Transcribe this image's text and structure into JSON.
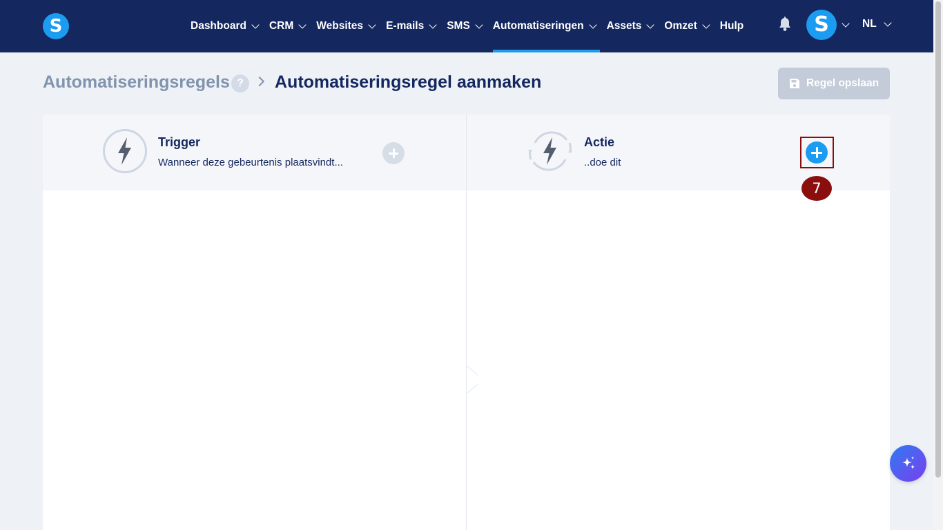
{
  "nav": {
    "logo_letter": "S",
    "items": [
      {
        "label": "Dashboard",
        "has_dropdown": true,
        "active": false
      },
      {
        "label": "CRM",
        "has_dropdown": true,
        "active": false
      },
      {
        "label": "Websites",
        "has_dropdown": true,
        "active": false
      },
      {
        "label": "E-mails",
        "has_dropdown": true,
        "active": false
      },
      {
        "label": "SMS",
        "has_dropdown": true,
        "active": false
      },
      {
        "label": "Automatiseringen",
        "has_dropdown": true,
        "active": true
      },
      {
        "label": "Assets",
        "has_dropdown": true,
        "active": false
      },
      {
        "label": "Omzet",
        "has_dropdown": true,
        "active": false
      },
      {
        "label": "Hulp",
        "has_dropdown": false,
        "active": false
      }
    ],
    "avatar_letter": "S",
    "language": "NL"
  },
  "header": {
    "breadcrumb_root": "Automatiseringsregels",
    "help_label": "?",
    "page_title": "Automatiseringsregel aanmaken",
    "save_label": "Regel opslaan"
  },
  "trigger": {
    "title": "Trigger",
    "subtitle": "Wanneer deze gebeurtenis plaatsvindt..."
  },
  "action": {
    "title": "Actie",
    "subtitle": "..doe dit"
  },
  "annotation": {
    "step_number": "7"
  },
  "colors": {
    "nav_bg": "#14275e",
    "accent": "#1b9cf0",
    "page_bg": "#eef2f7",
    "annotation": "#8b0e0e",
    "disabled": "#c3ccd8"
  }
}
